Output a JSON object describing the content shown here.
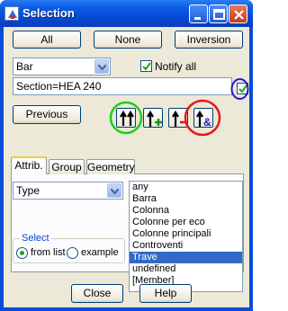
{
  "window": {
    "title": "Selection"
  },
  "buttons": {
    "all": "All",
    "none": "None",
    "inversion": "Inversion",
    "previous": "Previous",
    "close": "Close",
    "help": "Help"
  },
  "element_type": {
    "selected": "Bar"
  },
  "notify": {
    "label": "Notify all",
    "checked": true
  },
  "criteria": {
    "value": "Section=HEA 240"
  },
  "tabs": [
    {
      "label": "Attrib."
    },
    {
      "label": "Group"
    },
    {
      "label": "Geometry"
    }
  ],
  "attribute": {
    "selected": "Type"
  },
  "values_list": [
    "any",
    "Barra",
    "Colonna",
    "Colonne per eco",
    "Colonne principali",
    "Controventi",
    "Trave",
    "undefined",
    "[Member]"
  ],
  "selected_value": "Trave",
  "select_group": {
    "label": "Select",
    "from_list": "from list",
    "example": "example",
    "selected": "from list"
  },
  "tool_labels": {
    "add_plus": "+",
    "remove_minus": "-",
    "and": "&"
  },
  "colors": {
    "highlight_green": "#19d019",
    "highlight_red": "#e21a1a",
    "highlight_blue": "#1a1adc",
    "selection": "#316ac5"
  }
}
